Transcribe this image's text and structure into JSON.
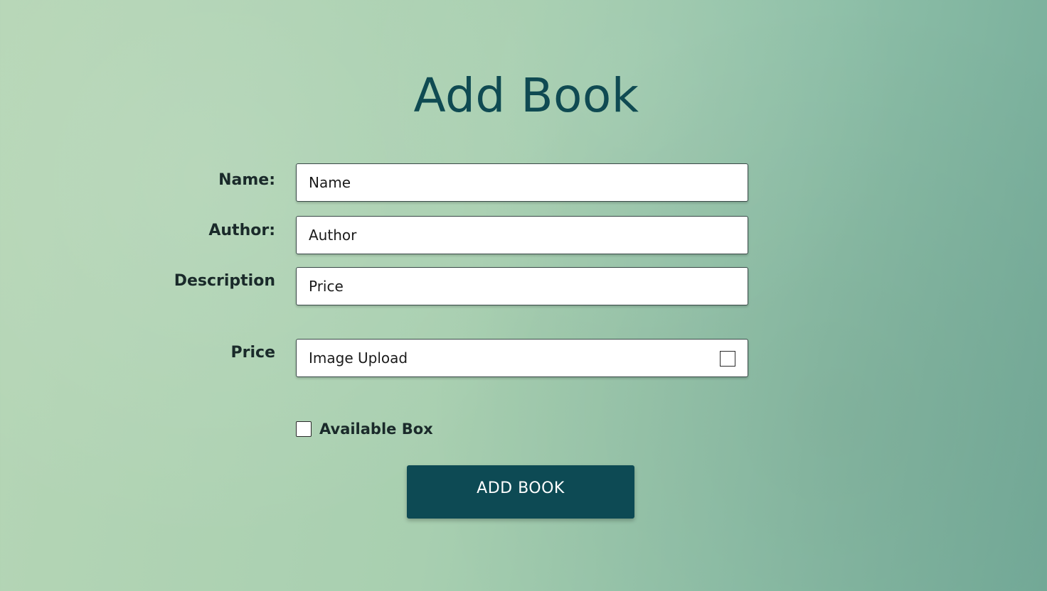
{
  "page": {
    "title": "Add Book"
  },
  "form": {
    "labels": {
      "name": "Name:",
      "author": "Author:",
      "description": "Description",
      "price": "Price"
    },
    "fields": {
      "name": "Name",
      "author": "Author",
      "description": "Price",
      "price": "Image Upload"
    },
    "available_label": "Available Box",
    "submit_label": "ADD BOOK"
  },
  "colors": {
    "title": "#0f4a52",
    "button": "#0d4a54",
    "background_start": "#b6d6b6",
    "background_end": "#74ab99"
  },
  "icons": {
    "upload": "square-checkbox-icon",
    "available": "checkbox-icon"
  }
}
